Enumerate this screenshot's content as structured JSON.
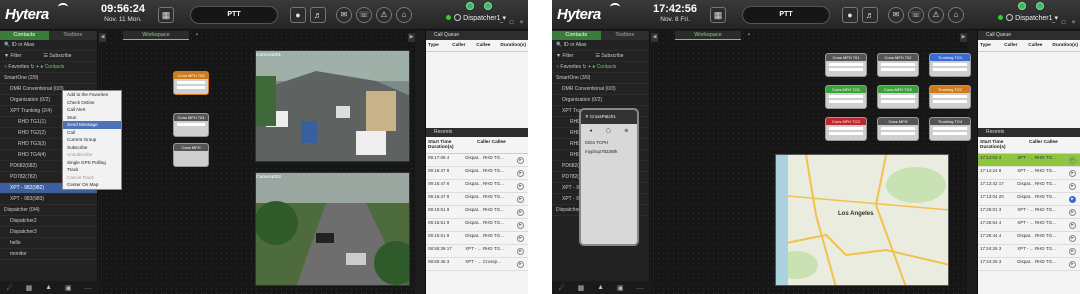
{
  "screen1": {
    "brand": "Hytera",
    "time": "09:56:24",
    "date": "Nov. 11 Mon.",
    "ptt": "PTT",
    "dispatcher": "Dispatcher1",
    "tabs": [
      "Contacts",
      "Toolbox"
    ],
    "search_placeholder": "ID or Alias",
    "filter": "Filter",
    "subscribe": "Subscribe",
    "favorites": "Favorites",
    "contacts": "Contacts",
    "tree": [
      "SmartOne (2/9)",
      "DMR Conventional (0/3)",
      "Organization (0/2)",
      "XPT Trunking (2/4)",
      "RHD TG1(1)",
      "RHD TG2(2)",
      "RHD TG3(3)",
      "RHD TG4(4)",
      "PD682(682)",
      "PD782(782)",
      "XPT - 982(982)",
      "XPT - 983(983)",
      "Dispatcher (0/4)",
      "Dispatcher2",
      "Dispatcher3",
      "hello",
      "monitor"
    ],
    "workspace_tab": "Workspace",
    "context_menu": [
      "Add to the Favorites",
      "Check Online",
      "Call Alert",
      "Stun",
      "Send Message",
      "Call",
      "Current Group",
      "Subscribe",
      "Unsubscribe",
      "Single GPS Polling",
      "Track",
      "Cancel Track",
      "Center On Map"
    ],
    "cameras": [
      {
        "name": "Camera001",
        "info": "Bentuan Rd. 10:56  Henshan District"
      },
      {
        "name": "Camera002",
        "info": "Longzhen Rd. 10:56  Henshan District"
      }
    ],
    "call_cards": [
      "Cons MFH 703",
      "Cons MFH 704",
      "Cons MFH"
    ],
    "call_queue": "Call Queue",
    "queue_cols": [
      "Type",
      "Caller",
      "Callee",
      "Duration(s)"
    ],
    "recents": "Recents",
    "recent_cols": [
      "Start Time Duration(s)",
      "Caller Callee"
    ],
    "recent_rows": [
      [
        "09:17:08 4",
        "Dispat... RHD TG..."
      ],
      [
        "09:16:47 8",
        "Dispat... RHD TG..."
      ],
      [
        "09:16:47 8",
        "Dispat... RHD TG..."
      ],
      [
        "09:16:47 8",
        "Dispat... RHD TG..."
      ],
      [
        "09:15:51 9",
        "Dispat... RHD TG..."
      ],
      [
        "09:15:51 9",
        "Dispat... RHD TG..."
      ],
      [
        "09:15:51 9",
        "Dispat... RHD TG..."
      ],
      [
        "08:55:39 17",
        "XPT - ... RHD TG..."
      ],
      [
        "08:55:46 3",
        "XPT - ... Crossp..."
      ]
    ]
  },
  "screen2": {
    "brand": "Hytera",
    "time": "17:42:56",
    "date": "Nov. 8 Fri.",
    "ptt": "PTT",
    "dispatcher": "Dispatcher1",
    "tabs": [
      "Contacts",
      "Toolbox"
    ],
    "search_placeholder": "ID or Alias",
    "filter": "Filter",
    "subscribe": "Subscribe",
    "favorites": "Favorites",
    "contacts": "Contacts",
    "tree": [
      "SmartOne (3/9)",
      "DMR Conventional (0/3)",
      "Organization (0/2)",
      "XPT Trunking (3/4)",
      "RHD TG1(1)",
      "RHD TG2(2)",
      "RHD TG3(3)",
      "RHD TG4(4)",
      "PD682(682)",
      "PD782(782)",
      "XPT - 982(982)",
      "XPT - 983(983)",
      "Dispatcher (0/4)"
    ],
    "workspace_tab": "Workspace",
    "patch_title": "CrossPatch1",
    "patch_lines": [
      "0204 TCPH",
      "myphup7833Wk"
    ],
    "call_cards": [
      {
        "label": "Cons MFH 701",
        "color": "#c9c9c9"
      },
      {
        "label": "Cons MFH 702",
        "color": "#c9c9c9"
      },
      {
        "label": "Trunking TG1",
        "color": "#3a6bd0"
      },
      {
        "label": "Cons MFH TG1",
        "color": "#3aa03a"
      },
      {
        "label": "Cons MFH TG2",
        "color": "#3aa03a"
      },
      {
        "label": "Trunking TG2",
        "color": "#d07a1a"
      },
      {
        "label": "Cons MFH TG2",
        "color": "#c0262c"
      },
      {
        "label": "Cons MFH",
        "color": "#c9c9c9"
      },
      {
        "label": "Trunking TG4",
        "color": "#c9c9c9"
      }
    ],
    "map_city": "Los Angeles",
    "call_queue": "Call Queue",
    "queue_cols": [
      "Type",
      "Caller",
      "Callee",
      "Duration(s)"
    ],
    "recents": "Recents",
    "recent_cols": [
      "Start Time Duration(s)",
      "Caller Callee"
    ],
    "recent_rows": [
      [
        "17:14:02 4",
        "XPT - ... RHD TG..."
      ],
      [
        "17:14:24 8",
        "XPT - ... RHD TG..."
      ],
      [
        "17:13:42 17",
        "Dispat... RHD TG..."
      ],
      [
        "17:13:04 20",
        "Dispat... RHD TG..."
      ],
      [
        "17:26:01 3",
        "XPT - ... RHD TG..."
      ],
      [
        "17:25:54 4",
        "XPT - ... RHD TG..."
      ],
      [
        "17:25:44 4",
        "Dispat... RHD TG..."
      ],
      [
        "17:24:26 3",
        "XPT - ... RHD TG..."
      ],
      [
        "17:24:26 3",
        "Dispat... RHD TG..."
      ]
    ]
  }
}
